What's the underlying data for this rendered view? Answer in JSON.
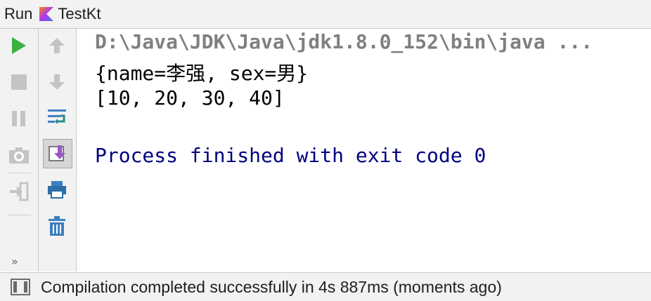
{
  "titlebar": {
    "run_label": "Run",
    "tab_name": "TestKt",
    "tab_icon": "kotlin-icon"
  },
  "left_toolbar": {
    "buttons": [
      {
        "name": "rerun-button",
        "icon": "play-icon",
        "color": "#3bb13f"
      },
      {
        "name": "stop-button",
        "icon": "stop-icon",
        "color": "#bdbdbd"
      },
      {
        "name": "pause-button",
        "icon": "pause-icon",
        "color": "#bdbdbd"
      },
      {
        "name": "dump-threads-button",
        "icon": "camera-icon",
        "color": "#bdbdbd"
      },
      {
        "name": "exit-button",
        "icon": "exit-icon",
        "color": "#bdbdbd"
      }
    ],
    "more_label": "»"
  },
  "right_toolbar": {
    "buttons": [
      {
        "name": "up-stack-button",
        "icon": "arrow-up-icon"
      },
      {
        "name": "down-stack-button",
        "icon": "arrow-down-icon"
      },
      {
        "name": "soft-wrap-button",
        "icon": "soft-wrap-icon"
      },
      {
        "name": "scroll-to-end-button",
        "icon": "scroll-to-end-icon",
        "active": true
      },
      {
        "name": "print-button",
        "icon": "printer-icon"
      },
      {
        "name": "clear-all-button",
        "icon": "trash-icon"
      }
    ]
  },
  "console": {
    "command_line": "D:\\Java\\JDK\\Java\\jdk1.8.0_152\\bin\\java ...",
    "output_line_1": "{name=李强, sex=男}",
    "output_line_2": "[10, 20, 30, 40]",
    "exit_message": "Process finished with exit code 0"
  },
  "statusbar": {
    "icon": "layout-icon",
    "message": "Compilation completed successfully in 4s 887ms (moments ago)"
  },
  "colors": {
    "command": "#808080",
    "output": "#000000",
    "exit": "#000080",
    "play": "#3bb13f",
    "accent": "#3d7fc1"
  }
}
